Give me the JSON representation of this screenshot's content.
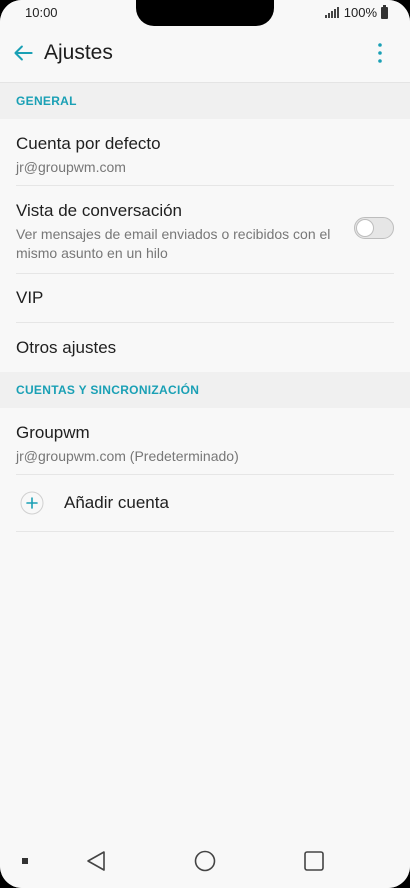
{
  "status": {
    "time": "10:00",
    "battery": "100%"
  },
  "appbar": {
    "title": "Ajustes"
  },
  "general": {
    "header": "GENERAL",
    "default_account": {
      "title": "Cuenta por defecto",
      "subtitle": "jr@groupwm.com"
    },
    "conversation_view": {
      "title": "Vista de conversación",
      "subtitle": "Ver mensajes de email enviados o recibidos con el mismo asunto en un hilo",
      "enabled": false
    },
    "vip": {
      "title": "VIP"
    },
    "other_settings": {
      "title": "Otros ajustes"
    }
  },
  "accounts": {
    "header": "CUENTAS Y SINCRONIZACIÓN",
    "account": {
      "title": "Groupwm",
      "subtitle": "jr@groupwm.com (Predeterminado)"
    },
    "add_account": {
      "label": "Añadir cuenta"
    }
  },
  "colors": {
    "accent": "#1aa0b5",
    "background": "#f8f8f8",
    "section_bg": "#f0f0f0"
  },
  "icons": {
    "back": "arrow-left-icon",
    "more": "more-vertical-icon",
    "add": "plus-circle-icon"
  }
}
